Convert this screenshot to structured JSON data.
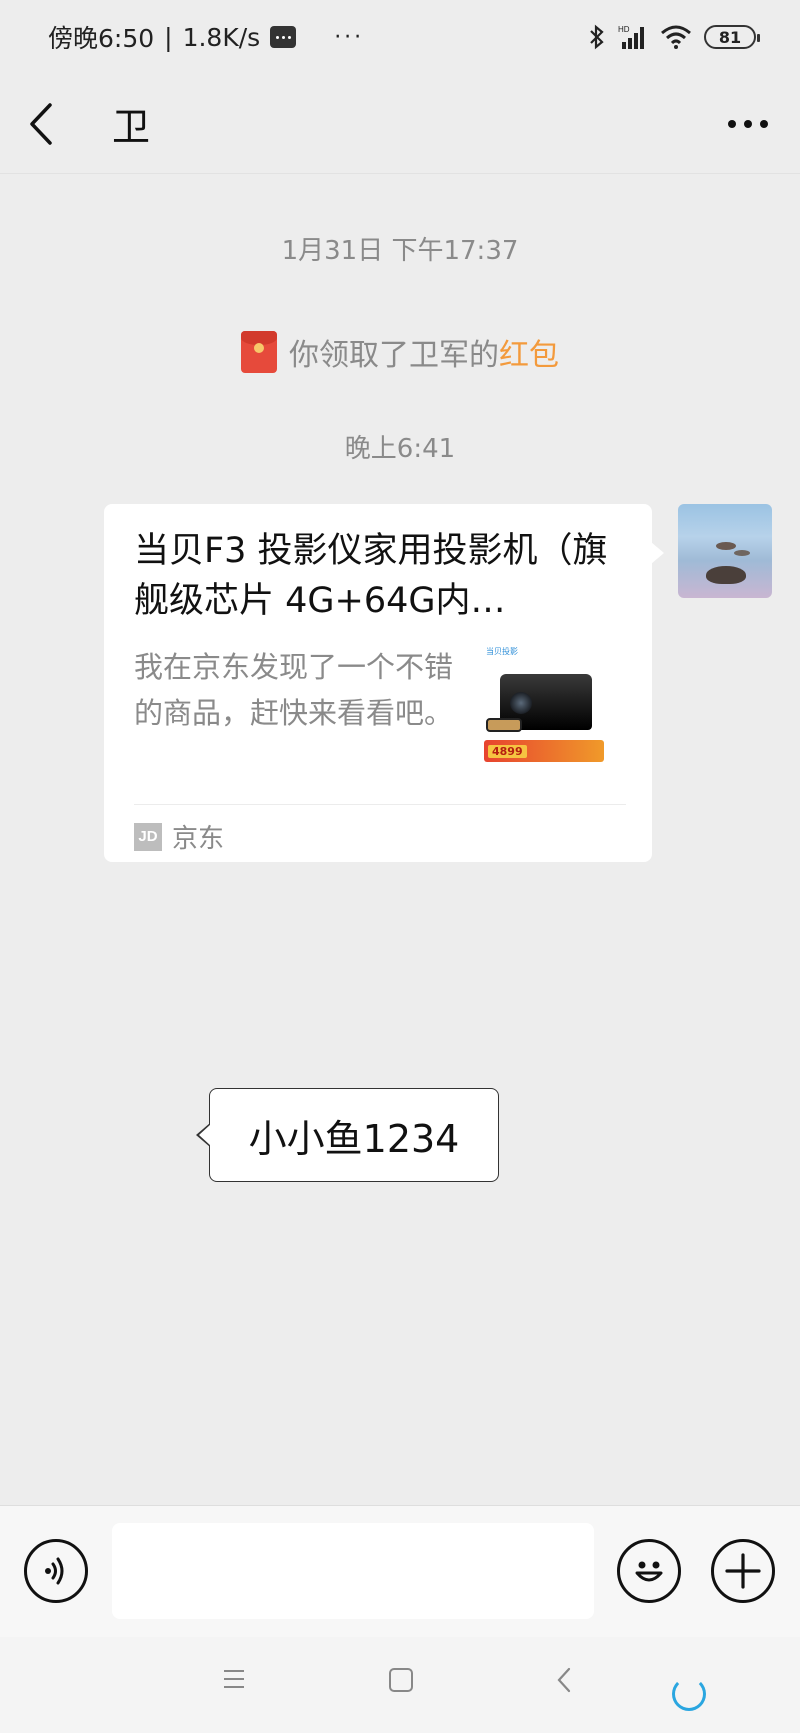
{
  "status_bar": {
    "time": "傍晚6:50",
    "separator": "|",
    "network_speed": "1.8K/s",
    "more": "···",
    "battery": "81",
    "signal_label": "HD"
  },
  "header": {
    "title": "卫"
  },
  "messages": {
    "timestamp_1": "1月31日 下午17:37",
    "redpacket_notice": {
      "prefix": "你领取了卫军的",
      "link": "红包"
    },
    "timestamp_2": "晚上6:41",
    "link_card": {
      "title": "当贝F3 投影仪家用投影机（旗舰级芯片 4G+64G内…",
      "description": "我在京东发现了一个不错的商品，赶快来看看吧。",
      "thumb_brand": "当贝投影",
      "thumb_price": "4899",
      "source_logo": "JD",
      "source": "京东"
    },
    "text_bubble": "小小鱼1234"
  },
  "input": {
    "value": "",
    "placeholder": ""
  },
  "colors": {
    "chat_background": "#EDEDED",
    "redpacket_link": "#F39A3C",
    "redpacket_icon": "#E64A3B"
  },
  "icons": {
    "back": "chevron-left-icon",
    "more": "more-dots-icon",
    "voice": "voice-icon",
    "emoji": "emoji-icon",
    "plus": "plus-icon"
  }
}
